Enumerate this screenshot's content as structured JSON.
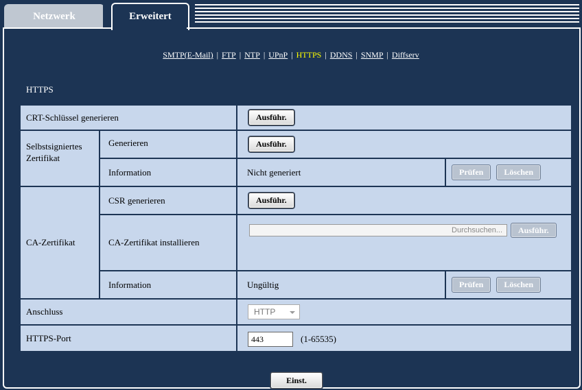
{
  "tabs": [
    {
      "label": "Netzwerk"
    },
    {
      "label": "Erweitert"
    }
  ],
  "subnav": [
    {
      "label": "SMTP(E-Mail)"
    },
    {
      "label": "FTP"
    },
    {
      "label": "NTP"
    },
    {
      "label": "UPnP"
    },
    {
      "label": "HTTPS"
    },
    {
      "label": "DDNS"
    },
    {
      "label": "SNMP"
    },
    {
      "label": "Diffserv"
    }
  ],
  "subnav_separator": "|",
  "section_title": "HTTPS",
  "crt": {
    "label": "CRT-Schlüssel generieren",
    "button": "Ausführ."
  },
  "self_signed": {
    "group_label": "Selbstsigniertes Zertifikat",
    "generate_label": "Generieren",
    "generate_button": "Ausführ.",
    "info_label": "Information",
    "info_value": "Nicht generiert",
    "check_button": "Prüfen",
    "delete_button": "Löschen"
  },
  "ca": {
    "group_label": "CA-Zertifikat",
    "csr_label": "CSR generieren",
    "csr_button": "Ausführ.",
    "install_label": "CA-Zertifikat installieren",
    "browse_text": "Durchsuchen...",
    "install_button": "Ausführ.",
    "info_label": "Information",
    "info_value": "Ungültig",
    "check_button": "Prüfen",
    "delete_button": "Löschen"
  },
  "connection": {
    "label": "Anschluss",
    "selected": "HTTP"
  },
  "https_port": {
    "label": "HTTPS-Port",
    "value": "443",
    "range": "(1-65535)"
  },
  "set_button": "Einst."
}
